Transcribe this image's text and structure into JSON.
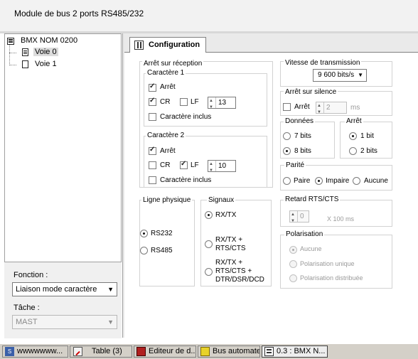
{
  "header": {
    "title": "Module de bus 2 ports RS485/232"
  },
  "tree": {
    "root": "BMX NOM 0200",
    "items": [
      "Voie 0",
      "Voie 1"
    ]
  },
  "left_bottom": {
    "fonction_label": "Fonction :",
    "fonction_value": "Liaison mode caractère",
    "tache_label": "Tâche :",
    "tache_value": "MAST"
  },
  "tab": {
    "label": "Configuration"
  },
  "arret_reception": {
    "title": "Arrêt sur réception",
    "car1": {
      "title": "Caractère 1",
      "arret": "Arrêt",
      "cr": "CR",
      "lf": "LF",
      "value": "13",
      "inclus": "Caractère inclus"
    },
    "car2": {
      "title": "Caractère 2",
      "arret": "Arrêt",
      "cr": "CR",
      "lf": "LF",
      "value": "10",
      "inclus": "Caractère inclus"
    }
  },
  "vitesse": {
    "title": "Vitesse de transmission",
    "value": "9 600 bits/s"
  },
  "arret_silence": {
    "title": "Arrêt sur silence",
    "arret": "Arrêt",
    "value": "2",
    "unit": "ms"
  },
  "donnees": {
    "title": "Données",
    "opt1": "7 bits",
    "opt2": "8 bits"
  },
  "arret_bits": {
    "title": "Arrêt",
    "opt1": "1 bit",
    "opt2": "2 bits"
  },
  "parite": {
    "title": "Parité",
    "opt1": "Paire",
    "opt2": "Impaire",
    "opt3": "Aucune"
  },
  "ligne": {
    "title": "Ligne physique",
    "opt1": "RS232",
    "opt2": "RS485"
  },
  "signaux": {
    "title": "Signaux",
    "opt1": "RX/TX",
    "opt2_l1": "RX/TX +",
    "opt2_l2": "RTS/CTS",
    "opt3_l1": "RX/TX +",
    "opt3_l2": "RTS/CTS +",
    "opt3_l3": "DTR/DSR/DCD"
  },
  "retard": {
    "title": "Retard RTS/CTS",
    "value": "0",
    "unit": "X 100 ms"
  },
  "polarisation": {
    "title": "Polarisation",
    "opt1": "Aucune",
    "opt2": "Polarisation unique",
    "opt3": "Polarisation distribuée"
  },
  "taskbar": {
    "items": [
      "wwwwwww...",
      "Table (3)",
      "Editeur de d...",
      "Bus automate",
      "0.3 : BMX N..."
    ]
  }
}
